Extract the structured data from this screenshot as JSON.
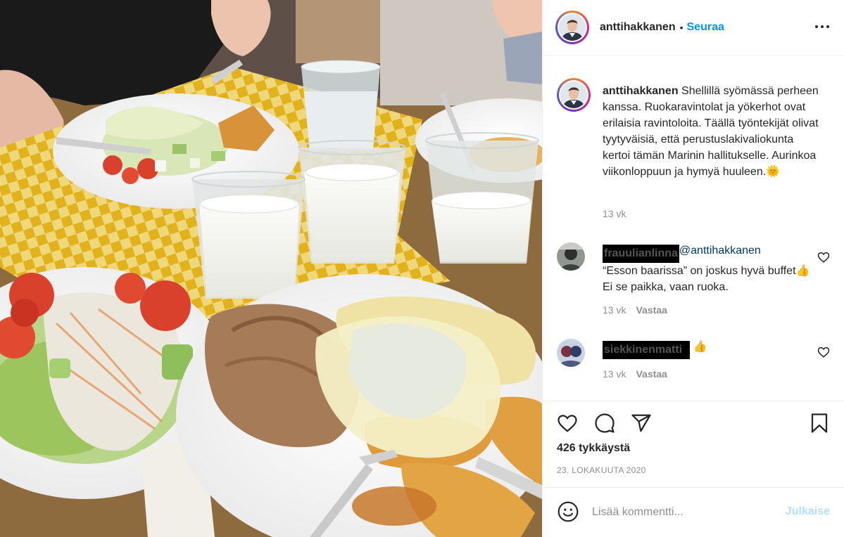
{
  "post": {
    "username": "anttihakkanen",
    "follow_separator": "•",
    "follow_label": "Seuraa",
    "more_icon": "more-horizontal-icon"
  },
  "caption": {
    "username": "anttihakkanen",
    "text": "Shellillä syömässä perheen kanssa. Ruokaravintolat ja yökerhot ovat erilaisia ravintoloita. Täällä työntekijät olivat tyytyväisiä, että perustuslakivaliokunta kertoi tämän Marinin hallitukselle. Aurinkoa viikonloppuun ja hymyä huuleen.",
    "emoji": "🌞",
    "time": "13 vk"
  },
  "comments": [
    {
      "username_censored": "frauulianlinna",
      "mention": "@anttihakkanen",
      "text": "“Esson baarissa” on joskus hyvä buffet",
      "emoji": "👍",
      "text2": " Ei se paikka, vaan ruoka.",
      "time": "13 vk",
      "reply_label": "Vastaa"
    },
    {
      "username_censored": "siekkinenmatti",
      "emoji": "👍",
      "time": "13 vk",
      "reply_label": "Vastaa"
    }
  ],
  "actions": {
    "like_icon": "heart-icon",
    "comment_icon": "comment-icon",
    "share_icon": "paper-plane-icon",
    "save_icon": "bookmark-icon"
  },
  "likes_text": "426 tykkäystä",
  "date_text": "23. LOKAKUUTA 2020",
  "add_comment": {
    "placeholder": "Lisää kommentti...",
    "post_label": "Julkaise",
    "emoji_icon": "smiley-icon"
  },
  "colors": {
    "accent_blue": "#0095f6",
    "post_disabled": "#b2dffc",
    "muted_text": "#8e8e8e",
    "text": "#262626",
    "tray_yellow": "#e8b820"
  }
}
